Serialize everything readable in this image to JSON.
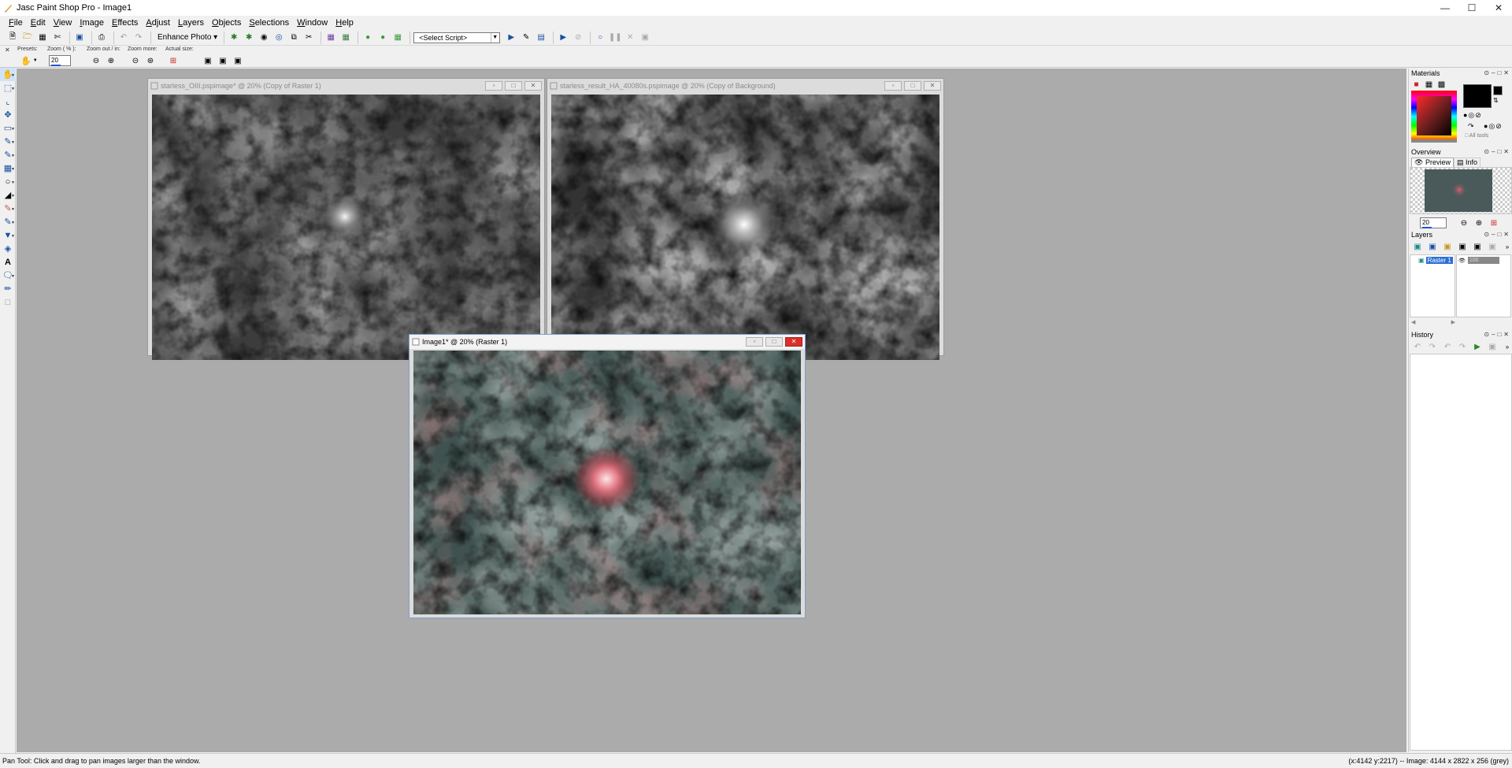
{
  "app": {
    "title": "Jasc Paint Shop Pro - Image1",
    "window_controls": [
      "minimize",
      "maximize",
      "close"
    ]
  },
  "menu": [
    {
      "label": "File",
      "u": "F",
      "rest": "ile"
    },
    {
      "label": "Edit",
      "u": "E",
      "rest": "dit"
    },
    {
      "label": "View",
      "u": "V",
      "rest": "iew"
    },
    {
      "label": "Image",
      "u": "I",
      "rest": "mage"
    },
    {
      "label": "Effects",
      "u": "E",
      "rest": "ffects"
    },
    {
      "label": "Adjust",
      "u": "A",
      "rest": "djust"
    },
    {
      "label": "Layers",
      "u": "L",
      "rest": "ayers"
    },
    {
      "label": "Objects",
      "u": "O",
      "rest": "bjects"
    },
    {
      "label": "Selections",
      "u": "S",
      "rest": "elections"
    },
    {
      "label": "Window",
      "u": "W",
      "rest": "indow"
    },
    {
      "label": "Help",
      "u": "H",
      "rest": "elp"
    }
  ],
  "toolbar": {
    "enhance_photo": "Enhance Photo",
    "script_select": "<Select Script>"
  },
  "tool_options": {
    "presets_label": "Presets:",
    "zoom_label": "Zoom ( % ):",
    "zoom_value": "20",
    "zoom_out_in_label": "Zoom out / in:",
    "zoom_more_label": "Zoom more:",
    "actual_size_label": "Actual size:"
  },
  "windows": {
    "oiii": {
      "title": "starless_OIII.pspimage* @  20% (Copy of Raster 1)"
    },
    "ha": {
      "title": "starless_result_HA_40080s.pspimage @  20% (Copy of Background)"
    },
    "image1": {
      "title": "Image1* @  20% (Raster 1)"
    }
  },
  "panels": {
    "materials": {
      "title": "Materials",
      "all_tools": "All tools",
      "fg_color": "#000000",
      "bg_color": "#000000"
    },
    "overview": {
      "title": "Overview",
      "tab_preview": "Preview",
      "tab_info": "Info",
      "zoom_value": "20"
    },
    "layers": {
      "title": "Layers",
      "layer_name": "Raster 1",
      "opacity": "100"
    },
    "history": {
      "title": "History"
    }
  },
  "status": {
    "left": "Pan Tool: Click and drag to pan images larger than the window.",
    "right": "(x:4142 y:2217) -- Image:  4144 x 2822 x 256 (grey)"
  },
  "colors": {
    "workspace": "#ababab",
    "accent": "#2255cc",
    "close_red": "#d9302a",
    "nebula_red": "#d04a55",
    "nebula_teal": "#3f524f"
  }
}
